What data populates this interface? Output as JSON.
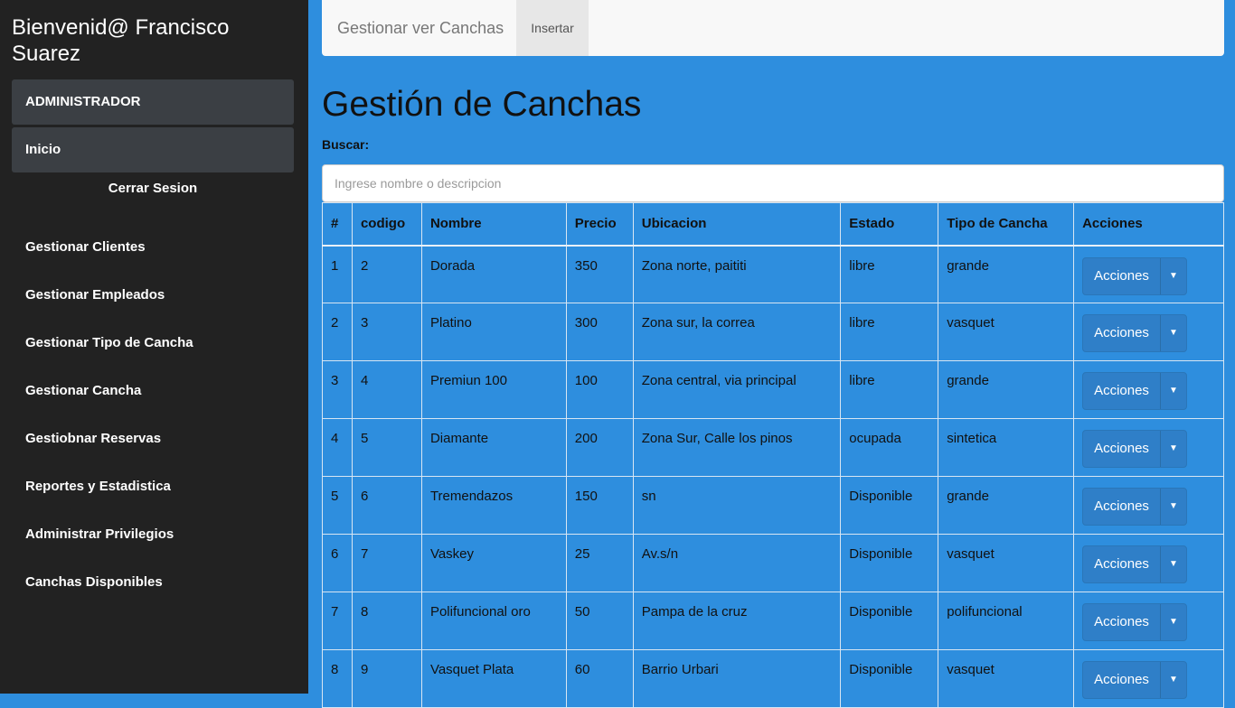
{
  "sidebar": {
    "welcome": "Bienvenid@ Francisco Suarez",
    "admin_label": "ADMINISTRADOR",
    "home_label": "Inicio",
    "logout_label": "Cerrar Sesion",
    "items": [
      {
        "label": "Gestionar Clientes"
      },
      {
        "label": "Gestionar Empleados"
      },
      {
        "label": "Gestionar Tipo de Cancha"
      },
      {
        "label": "Gestionar Cancha"
      },
      {
        "label": "Gestiobnar Reservas"
      },
      {
        "label": "Reportes y Estadistica"
      },
      {
        "label": "Administrar Privilegios"
      },
      {
        "label": "Canchas Disponibles"
      }
    ]
  },
  "topbar": {
    "brand": "Gestionar ver Canchas",
    "insert_label": "Insertar"
  },
  "main": {
    "title": "Gestión de Canchas",
    "search_label": "Buscar:",
    "search_placeholder": "Ingrese nombre o descripcion",
    "search_value": ""
  },
  "table": {
    "headers": [
      "#",
      "codigo",
      "Nombre",
      "Precio",
      "Ubicacion",
      "Estado",
      "Tipo de Cancha",
      "Acciones"
    ],
    "action_label": "Acciones",
    "action_caret": "▼",
    "rows": [
      {
        "n": "1",
        "codigo": "2",
        "nombre": "Dorada",
        "precio": "350",
        "ubicacion": "Zona norte, paititi",
        "estado": "libre",
        "tipo": "grande"
      },
      {
        "n": "2",
        "codigo": "3",
        "nombre": "Platino",
        "precio": "300",
        "ubicacion": "Zona sur, la correa",
        "estado": "libre",
        "tipo": "vasquet"
      },
      {
        "n": "3",
        "codigo": "4",
        "nombre": "Premiun 100",
        "precio": "100",
        "ubicacion": "Zona central, via principal",
        "estado": "libre",
        "tipo": "grande"
      },
      {
        "n": "4",
        "codigo": "5",
        "nombre": "Diamante",
        "precio": "200",
        "ubicacion": "Zona Sur, Calle los pinos",
        "estado": "ocupada",
        "tipo": "sintetica"
      },
      {
        "n": "5",
        "codigo": "6",
        "nombre": "Tremendazos",
        "precio": "150",
        "ubicacion": "sn",
        "estado": "Disponible",
        "tipo": "grande"
      },
      {
        "n": "6",
        "codigo": "7",
        "nombre": "Vaskey",
        "precio": "25",
        "ubicacion": "Av.s/n",
        "estado": "Disponible",
        "tipo": "vasquet"
      },
      {
        "n": "7",
        "codigo": "8",
        "nombre": "Polifuncional oro",
        "precio": "50",
        "ubicacion": "Pampa de la cruz",
        "estado": "Disponible",
        "tipo": "polifuncional"
      },
      {
        "n": "8",
        "codigo": "9",
        "nombre": "Vasquet Plata",
        "precio": "60",
        "ubicacion": "Barrio Urbari",
        "estado": "Disponible",
        "tipo": "vasquet"
      }
    ]
  },
  "colors": {
    "sidebar_bg": "#222222",
    "main_bg": "#2e8ede",
    "button_bg": "#2f7fc8"
  }
}
